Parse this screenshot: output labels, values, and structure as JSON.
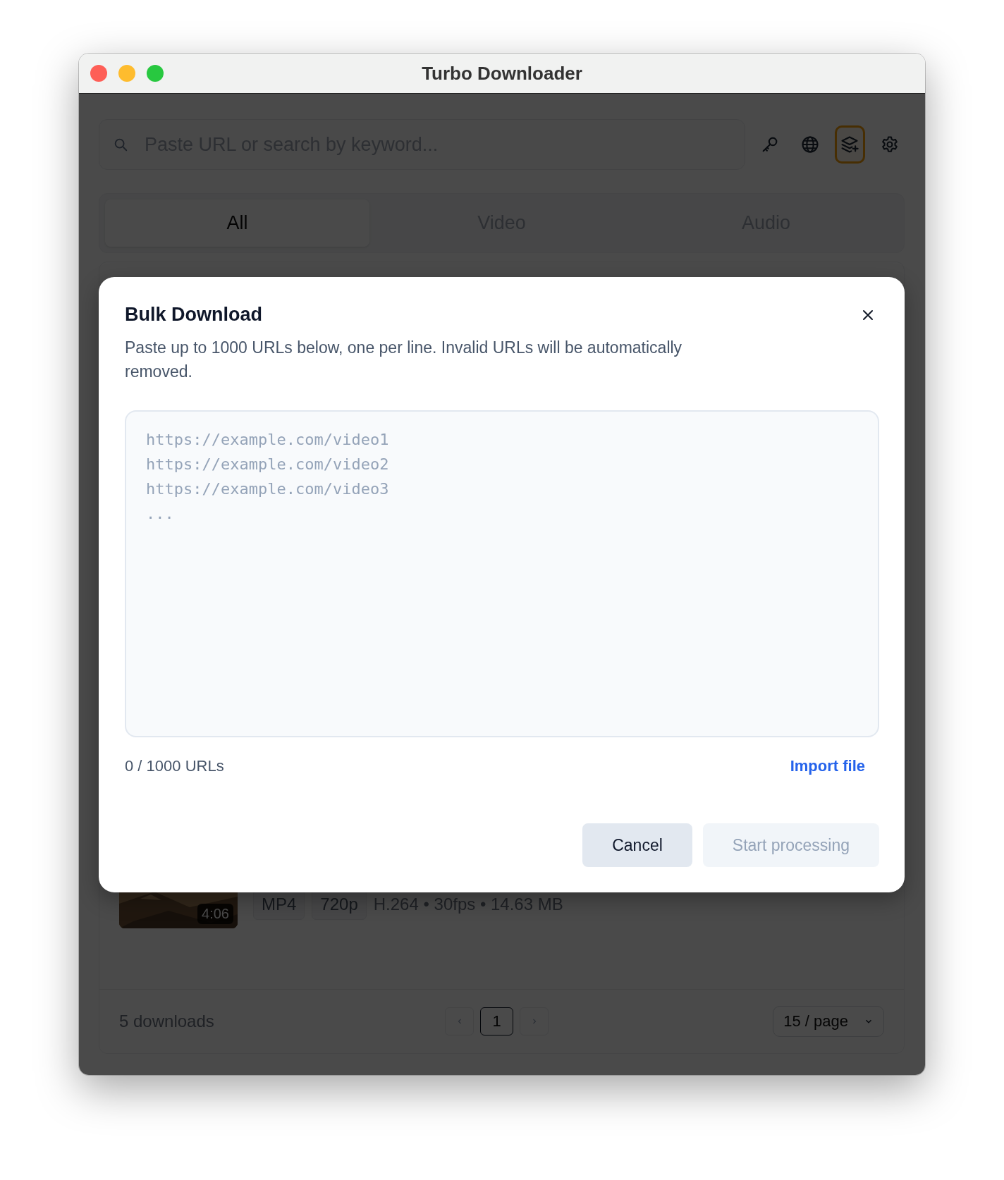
{
  "window": {
    "title": "Turbo Downloader"
  },
  "toolbar": {
    "search": {
      "placeholder": "Paste URL or search by keyword..."
    },
    "buttons": [
      {
        "kind": "key",
        "selected": false
      },
      {
        "kind": "globe",
        "selected": false
      },
      {
        "kind": "bulk",
        "selected": true
      },
      {
        "kind": "settings",
        "selected": false
      }
    ]
  },
  "tabs": [
    {
      "label": "All",
      "selected": true
    },
    {
      "label": "Video",
      "selected": false
    },
    {
      "label": "Audio",
      "selected": false
    }
  ],
  "downloads": [
    {
      "thumbnail": {
        "kind": "picture"
      },
      "duration": "4:06",
      "tags": [
        "MP4",
        "720p"
      ],
      "details": "H.264 • 30fps • 14.63 MB"
    }
  ],
  "footer": {
    "count": "5 downloads",
    "pages": [
      {
        "label": "1",
        "selected": true
      }
    ],
    "page_size": "15 / page"
  },
  "dialog": {
    "title": "Bulk Download",
    "description": "Paste up to 1000 URLs below, one per line. Invalid URLs will be automatically removed.",
    "placeholder_lines": [
      "https://example.com/video1",
      "https://example.com/video2",
      "https://example.com/video3",
      "..."
    ],
    "counter": "0 / 1000 URLs",
    "import": "Import file",
    "buttons": [
      {
        "label": "Cancel",
        "kind": "secondary",
        "disabled": false
      },
      {
        "label": "Start processing",
        "kind": "primary",
        "disabled": true
      }
    ]
  }
}
